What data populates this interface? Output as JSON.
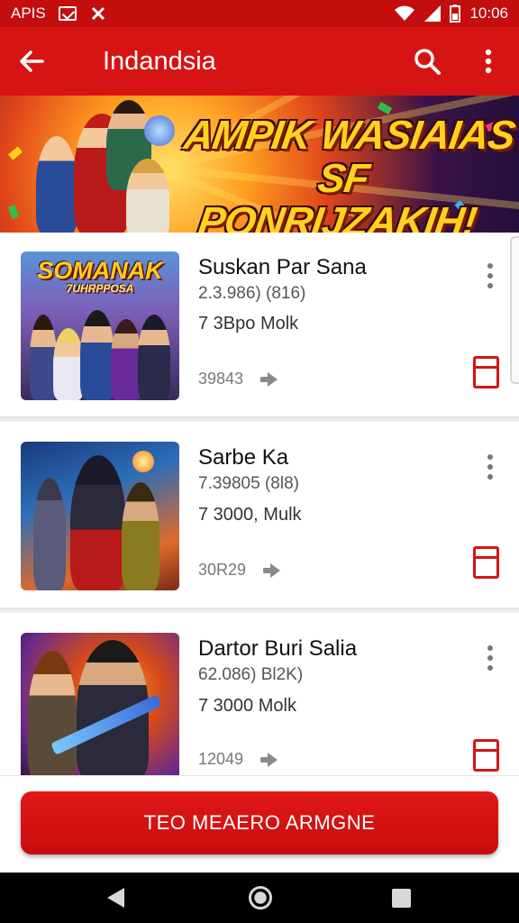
{
  "status_bar": {
    "carrier": "APIS",
    "time": "10:06"
  },
  "app_bar": {
    "title": "Indandsia"
  },
  "banner": {
    "headline": "AMPIK WASIAIAS SF PONRIJZAKIH!"
  },
  "games": [
    {
      "thumb_logo": "SOMANAK",
      "thumb_logo_sub": "7UHRPPOSA",
      "title": "Suskan Par Sana",
      "subtitle": "2.3.986) (816)",
      "players": "7 3Bpo Molk",
      "count": "39843"
    },
    {
      "title": "Sarbe Ka",
      "subtitle": "7.39805 (8l8)",
      "players": "7 3000, Mulk",
      "count": "30R29"
    },
    {
      "title": "Dartor Buri Salia",
      "subtitle": "62.086) Bl2K)",
      "players": "7 3000 Molk",
      "count": "12049"
    }
  ],
  "cta": {
    "label": "TEO MEAERO ARMGNE"
  },
  "colors": {
    "primary_red": "#d61414",
    "status_red": "#c40d0d",
    "banner_yellow": "#ffd21e"
  },
  "icons": {
    "back": "arrow-left-icon",
    "search": "search-icon",
    "more": "more-vert-icon",
    "share": "arrow-right-icon",
    "save": "bookmark-icon"
  }
}
